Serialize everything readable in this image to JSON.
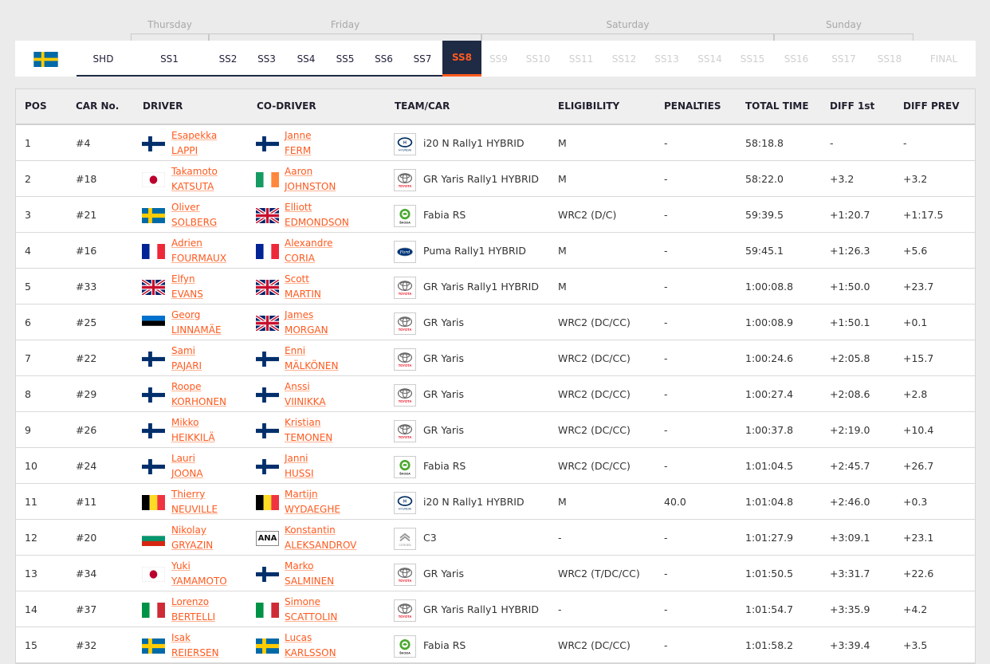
{
  "days": [
    "Thursday",
    "Friday",
    "Saturday",
    "Sunday"
  ],
  "stages": [
    "SHD",
    "SS1",
    "SS2",
    "SS3",
    "SS4",
    "SS5",
    "SS6",
    "SS7",
    "SS8",
    "SS9",
    "SS10",
    "SS11",
    "SS12",
    "SS13",
    "SS14",
    "SS15",
    "SS16",
    "SS17",
    "SS18",
    "FINAL"
  ],
  "active_stage": "SS8",
  "headers": {
    "pos": "POS",
    "car": "CAR No.",
    "driver": "DRIVER",
    "codriver": "CO-DRIVER",
    "team": "TEAM/CAR",
    "eligibility": "ELIGIBILITY",
    "penalties": "PENALTIES",
    "total": "TOTAL TIME",
    "diff1": "DIFF 1st",
    "diffprev": "DIFF PREV"
  },
  "rows": [
    {
      "pos": "1",
      "car": "#4",
      "driver_first": "Esapekka",
      "driver_last": "LAPPI",
      "driver_flag": "fi",
      "codriver_first": "Janne",
      "codriver_last": "FERM",
      "codriver_flag": "fi",
      "brand": "hyundai",
      "brand_text": "HYUNDAI",
      "model": "i20 N Rally1 HYBRID",
      "eligibility": "M",
      "penalties": "-",
      "total": "58:18.8",
      "diff1": "-",
      "diffprev": "-"
    },
    {
      "pos": "2",
      "car": "#18",
      "driver_first": "Takamoto",
      "driver_last": "KATSUTA",
      "driver_flag": "jp",
      "codriver_first": "Aaron",
      "codriver_last": "JOHNSTON",
      "codriver_flag": "ie",
      "brand": "toyota",
      "brand_text": "TOYOTA",
      "model": "GR Yaris Rally1 HYBRID",
      "eligibility": "M",
      "penalties": "-",
      "total": "58:22.0",
      "diff1": "+3.2",
      "diffprev": "+3.2"
    },
    {
      "pos": "3",
      "car": "#21",
      "driver_first": "Oliver",
      "driver_last": "SOLBERG",
      "driver_flag": "se",
      "codriver_first": "Elliott",
      "codriver_last": "EDMONDSON",
      "codriver_flag": "gb",
      "brand": "skoda",
      "brand_text": "ŠKODA",
      "model": "Fabia RS",
      "eligibility": "WRC2 (D/C)",
      "penalties": "-",
      "total": "59:39.5",
      "diff1": "+1:20.7",
      "diffprev": "+1:17.5"
    },
    {
      "pos": "4",
      "car": "#16",
      "driver_first": "Adrien",
      "driver_last": "FOURMAUX",
      "driver_flag": "fr",
      "codriver_first": "Alexandre",
      "codriver_last": "CORIA",
      "codriver_flag": "fr",
      "brand": "ford",
      "brand_text": "Ford",
      "model": "Puma Rally1 HYBRID",
      "eligibility": "M",
      "penalties": "-",
      "total": "59:45.1",
      "diff1": "+1:26.3",
      "diffprev": "+5.6"
    },
    {
      "pos": "5",
      "car": "#33",
      "driver_first": "Elfyn",
      "driver_last": "EVANS",
      "driver_flag": "gb",
      "codriver_first": "Scott",
      "codriver_last": "MARTIN",
      "codriver_flag": "gb",
      "brand": "toyota",
      "brand_text": "TOYOTA",
      "model": "GR Yaris Rally1 HYBRID",
      "eligibility": "M",
      "penalties": "-",
      "total": "1:00:08.8",
      "diff1": "+1:50.0",
      "diffprev": "+23.7"
    },
    {
      "pos": "6",
      "car": "#25",
      "driver_first": "Georg",
      "driver_last": "LINNAMÄE",
      "driver_flag": "ee",
      "codriver_first": "James",
      "codriver_last": "MORGAN",
      "codriver_flag": "gb",
      "brand": "toyota",
      "brand_text": "TOYOTA",
      "model": "GR Yaris",
      "eligibility": "WRC2 (DC/CC)",
      "penalties": "-",
      "total": "1:00:08.9",
      "diff1": "+1:50.1",
      "diffprev": "+0.1"
    },
    {
      "pos": "7",
      "car": "#22",
      "driver_first": "Sami",
      "driver_last": "PAJARI",
      "driver_flag": "fi",
      "codriver_first": "Enni",
      "codriver_last": "MÄLKÖNEN",
      "codriver_flag": "fi",
      "brand": "toyota",
      "brand_text": "TOYOTA",
      "model": "GR Yaris",
      "eligibility": "WRC2 (DC/CC)",
      "penalties": "-",
      "total": "1:00:24.6",
      "diff1": "+2:05.8",
      "diffprev": "+15.7"
    },
    {
      "pos": "8",
      "car": "#29",
      "driver_first": "Roope",
      "driver_last": "KORHONEN",
      "driver_flag": "fi",
      "codriver_first": "Anssi",
      "codriver_last": "VIINIKKA",
      "codriver_flag": "fi",
      "brand": "toyota",
      "brand_text": "TOYOTA",
      "model": "GR Yaris",
      "eligibility": "WRC2 (DC/CC)",
      "penalties": "-",
      "total": "1:00:27.4",
      "diff1": "+2:08.6",
      "diffprev": "+2.8"
    },
    {
      "pos": "9",
      "car": "#26",
      "driver_first": "Mikko",
      "driver_last": "HEIKKILÄ",
      "driver_flag": "fi",
      "codriver_first": "Kristian",
      "codriver_last": "TEMONEN",
      "codriver_flag": "fi",
      "brand": "toyota",
      "brand_text": "TOYOTA",
      "model": "GR Yaris",
      "eligibility": "WRC2 (DC/CC)",
      "penalties": "-",
      "total": "1:00:37.8",
      "diff1": "+2:19.0",
      "diffprev": "+10.4"
    },
    {
      "pos": "10",
      "car": "#24",
      "driver_first": "Lauri",
      "driver_last": "JOONA",
      "driver_flag": "fi",
      "codriver_first": "Janni",
      "codriver_last": "HUSSI",
      "codriver_flag": "fi",
      "brand": "skoda",
      "brand_text": "ŠKODA",
      "model": "Fabia RS",
      "eligibility": "WRC2 (DC/CC)",
      "penalties": "-",
      "total": "1:01:04.5",
      "diff1": "+2:45.7",
      "diffprev": "+26.7"
    },
    {
      "pos": "11",
      "car": "#11",
      "driver_first": "Thierry",
      "driver_last": "NEUVILLE",
      "driver_flag": "be",
      "codriver_first": "Martijn",
      "codriver_last": "WYDAEGHE",
      "codriver_flag": "be",
      "brand": "hyundai",
      "brand_text": "HYUNDAI",
      "model": "i20 N Rally1 HYBRID",
      "eligibility": "M",
      "penalties": "40.0",
      "total": "1:01:04.8",
      "diff1": "+2:46.0",
      "diffprev": "+0.3"
    },
    {
      "pos": "12",
      "car": "#20",
      "driver_first": "Nikolay",
      "driver_last": "GRYAZIN",
      "driver_flag": "bg",
      "codriver_first": "Konstantin",
      "codriver_last": "ALEKSANDROV",
      "codriver_flag": "ana",
      "codriver_flag_text": "ANA",
      "brand": "citroen",
      "brand_text": "CITROËN",
      "model": "C3",
      "eligibility": "-",
      "penalties": "-",
      "total": "1:01:27.9",
      "diff1": "+3:09.1",
      "diffprev": "+23.1"
    },
    {
      "pos": "13",
      "car": "#34",
      "driver_first": "Yuki",
      "driver_last": "YAMAMOTO",
      "driver_flag": "jp",
      "codriver_first": "Marko",
      "codriver_last": "SALMINEN",
      "codriver_flag": "fi",
      "brand": "toyota",
      "brand_text": "TOYOTA",
      "model": "GR Yaris",
      "eligibility": "WRC2 (T/DC/CC)",
      "penalties": "-",
      "total": "1:01:50.5",
      "diff1": "+3:31.7",
      "diffprev": "+22.6"
    },
    {
      "pos": "14",
      "car": "#37",
      "driver_first": "Lorenzo",
      "driver_last": "BERTELLI",
      "driver_flag": "it",
      "codriver_first": "Simone",
      "codriver_last": "SCATTOLIN",
      "codriver_flag": "it",
      "brand": "toyota",
      "brand_text": "TOYOTA",
      "model": "GR Yaris Rally1 HYBRID",
      "eligibility": "-",
      "penalties": "-",
      "total": "1:01:54.7",
      "diff1": "+3:35.9",
      "diffprev": "+4.2"
    },
    {
      "pos": "15",
      "car": "#32",
      "driver_first": "Isak",
      "driver_last": "REIERSEN",
      "driver_flag": "se",
      "codriver_first": "Lucas",
      "codriver_last": "KARLSSON",
      "codriver_flag": "se",
      "brand": "skoda",
      "brand_text": "ŠKODA",
      "model": "Fabia RS",
      "eligibility": "WRC2 (DC/CC)",
      "penalties": "-",
      "total": "1:01:58.2",
      "diff1": "+3:39.4",
      "diffprev": "+3.5"
    }
  ],
  "colors": {
    "accent": "#ff5a1f",
    "navy": "#1f2a44"
  }
}
